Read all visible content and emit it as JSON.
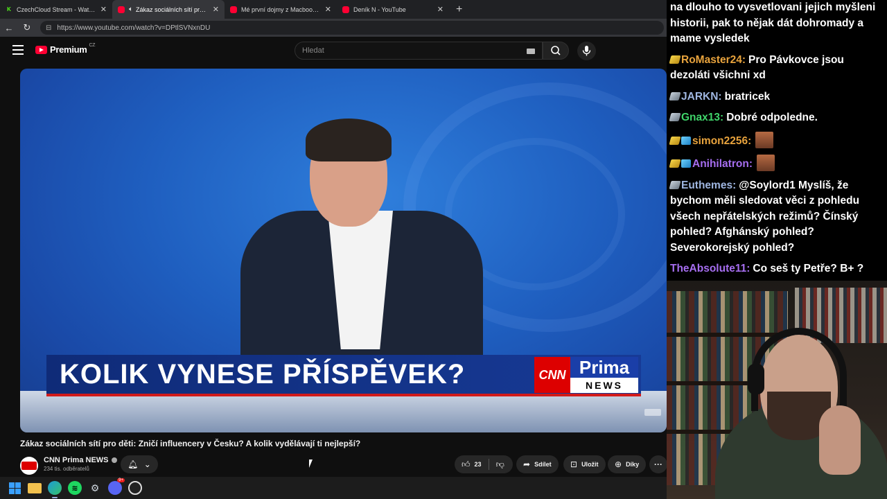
{
  "browser": {
    "tabs": [
      {
        "title": "CzechCloud Stream - Watch Live o",
        "favicon": "kick-icon",
        "active": false
      },
      {
        "title": "Zákaz sociálních sítí pro děti:",
        "favicon": "youtube-icon",
        "active": true,
        "audio": true
      },
      {
        "title": "Mé první dojmy z Macbook Neo.",
        "favicon": "youtube-icon",
        "active": false
      },
      {
        "title": "Deník N - YouTube",
        "favicon": "youtube-icon",
        "active": false
      }
    ],
    "new_tab_label": "+",
    "url": "https://www.youtube.com/watch?v=DPtlSVNxnDU"
  },
  "youtube": {
    "logo_text": "Premium",
    "region": "CZ",
    "search_placeholder": "Hledat",
    "video": {
      "headline": "KOLIK VYNESE PŘÍSPĚVEK?",
      "logo_cnn": "CNN",
      "logo_prima": "Prima",
      "logo_news": "NEWS"
    },
    "title": "Zákaz sociálních sítí pro děti: Zničí influencery v Česku? A kolik vydělávají ti nejlepší?",
    "channel": {
      "name": "CNN Prima NEWS",
      "subscribers": "234 tis. odběratelů"
    },
    "actions": {
      "likes": "23",
      "share": "Sdílet",
      "save": "Uložit",
      "thanks": "Díky",
      "more": "···"
    }
  },
  "chat": {
    "messages": [
      {
        "badges": [],
        "user": "",
        "user_color": "#ffffff",
        "text": "na dlouho to vysvetlovani jejich myšleni historii, pak to nějak dát dohromady a mame vysledek"
      },
      {
        "badges": [
          "gold"
        ],
        "user": "RoMaster24",
        "user_color": "#e8a33d",
        "text": "Pro Pávkovce jsou dezoláti všichni xd"
      },
      {
        "badges": [
          "silver"
        ],
        "user": "JARKN",
        "user_color": "#9fb6e0",
        "text": "bratricek"
      },
      {
        "badges": [
          "silver"
        ],
        "user": "Gnax13",
        "user_color": "#3fd46a",
        "text": "Dobré odpoledne."
      },
      {
        "badges": [
          "gold",
          "cube"
        ],
        "user": "simon2256",
        "user_color": "#e8a33d",
        "text": "",
        "emote": true
      },
      {
        "badges": [
          "gold",
          "cube"
        ],
        "user": "Anihilatron",
        "user_color": "#a66ef0",
        "text": "",
        "emote": true
      },
      {
        "badges": [
          "silver"
        ],
        "user": "Euthemes",
        "user_color": "#9fb6e0",
        "text": "@Soylord1 Myslíš, že bychom měli sledovat věci z pohledu všech nepřátelských režimů? Čínský pohled? Afghánský pohled? Severokorejský pohled?"
      },
      {
        "badges": [],
        "user": "TheAbsolute11",
        "user_color": "#a66ef0",
        "text": "Co seš ty Petře? B+ ?"
      }
    ]
  },
  "taskbar": {
    "apps": [
      "windows-start-icon",
      "file-explorer-icon",
      "edge-icon",
      "spotify-icon",
      "steam-icon",
      "discord-icon",
      "obs-icon"
    ],
    "discord_badge": "9+"
  }
}
